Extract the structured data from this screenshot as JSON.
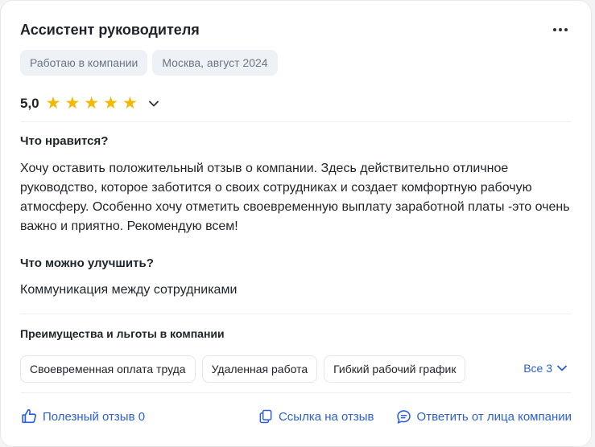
{
  "review": {
    "title": "Ассистент руководителя",
    "tags": [
      "Работаю в компании",
      "Москва, август 2024"
    ],
    "rating": {
      "value": "5,0",
      "stars": 5
    },
    "likes_heading": "Что нравится?",
    "likes_text": "Хочу оставить положительный отзыв о компании. Здесь действительно отличное руководство, которое заботится о своих сотрудниках и создает комфортную рабочую атмосферу. Особенно хочу отметить своевременную выплату заработной платы -это очень важно и приятно. Рекомендую всем!",
    "improve_heading": "Что можно улучшить?",
    "improve_text": "Коммуникация между сотрудниками"
  },
  "benefits": {
    "title": "Преимущества и льготы в компании",
    "chips": [
      "Своевременная оплата труда",
      "Удаленная работа",
      "Гибкий рабочий график"
    ],
    "all_label": "Все 3"
  },
  "footer": {
    "helpful_label": "Полезный отзыв 0",
    "link_label": "Ссылка на отзыв",
    "reply_label": "Ответить от лица компании"
  },
  "colors": {
    "accent": "#2b5fd9",
    "star": "#f5b800",
    "tag_bg": "#eef1f5"
  },
  "icons": [
    "more-icon",
    "star-icon",
    "chevron-down-icon",
    "thumbs-up-icon",
    "copy-link-icon",
    "chat-icon"
  ]
}
